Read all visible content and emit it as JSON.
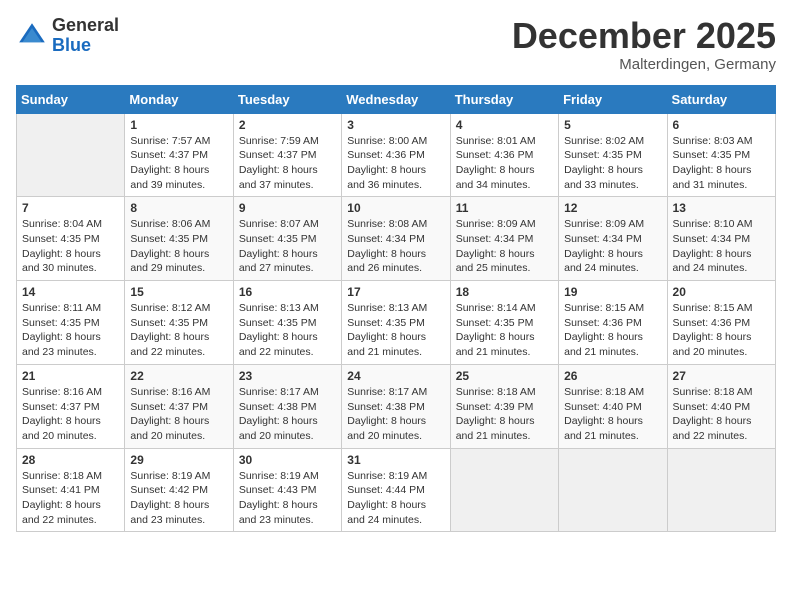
{
  "header": {
    "logo_general": "General",
    "logo_blue": "Blue",
    "month_title": "December 2025",
    "location": "Malterdingen, Germany"
  },
  "weekdays": [
    "Sunday",
    "Monday",
    "Tuesday",
    "Wednesday",
    "Thursday",
    "Friday",
    "Saturday"
  ],
  "weeks": [
    [
      {
        "day": "",
        "sunrise": "",
        "sunset": "",
        "daylight": "",
        "empty": true
      },
      {
        "day": "1",
        "sunrise": "Sunrise: 7:57 AM",
        "sunset": "Sunset: 4:37 PM",
        "daylight": "Daylight: 8 hours and 39 minutes."
      },
      {
        "day": "2",
        "sunrise": "Sunrise: 7:59 AM",
        "sunset": "Sunset: 4:37 PM",
        "daylight": "Daylight: 8 hours and 37 minutes."
      },
      {
        "day": "3",
        "sunrise": "Sunrise: 8:00 AM",
        "sunset": "Sunset: 4:36 PM",
        "daylight": "Daylight: 8 hours and 36 minutes."
      },
      {
        "day": "4",
        "sunrise": "Sunrise: 8:01 AM",
        "sunset": "Sunset: 4:36 PM",
        "daylight": "Daylight: 8 hours and 34 minutes."
      },
      {
        "day": "5",
        "sunrise": "Sunrise: 8:02 AM",
        "sunset": "Sunset: 4:35 PM",
        "daylight": "Daylight: 8 hours and 33 minutes."
      },
      {
        "day": "6",
        "sunrise": "Sunrise: 8:03 AM",
        "sunset": "Sunset: 4:35 PM",
        "daylight": "Daylight: 8 hours and 31 minutes."
      }
    ],
    [
      {
        "day": "7",
        "sunrise": "Sunrise: 8:04 AM",
        "sunset": "Sunset: 4:35 PM",
        "daylight": "Daylight: 8 hours and 30 minutes."
      },
      {
        "day": "8",
        "sunrise": "Sunrise: 8:06 AM",
        "sunset": "Sunset: 4:35 PM",
        "daylight": "Daylight: 8 hours and 29 minutes."
      },
      {
        "day": "9",
        "sunrise": "Sunrise: 8:07 AM",
        "sunset": "Sunset: 4:35 PM",
        "daylight": "Daylight: 8 hours and 27 minutes."
      },
      {
        "day": "10",
        "sunrise": "Sunrise: 8:08 AM",
        "sunset": "Sunset: 4:34 PM",
        "daylight": "Daylight: 8 hours and 26 minutes."
      },
      {
        "day": "11",
        "sunrise": "Sunrise: 8:09 AM",
        "sunset": "Sunset: 4:34 PM",
        "daylight": "Daylight: 8 hours and 25 minutes."
      },
      {
        "day": "12",
        "sunrise": "Sunrise: 8:09 AM",
        "sunset": "Sunset: 4:34 PM",
        "daylight": "Daylight: 8 hours and 24 minutes."
      },
      {
        "day": "13",
        "sunrise": "Sunrise: 8:10 AM",
        "sunset": "Sunset: 4:34 PM",
        "daylight": "Daylight: 8 hours and 24 minutes."
      }
    ],
    [
      {
        "day": "14",
        "sunrise": "Sunrise: 8:11 AM",
        "sunset": "Sunset: 4:35 PM",
        "daylight": "Daylight: 8 hours and 23 minutes."
      },
      {
        "day": "15",
        "sunrise": "Sunrise: 8:12 AM",
        "sunset": "Sunset: 4:35 PM",
        "daylight": "Daylight: 8 hours and 22 minutes."
      },
      {
        "day": "16",
        "sunrise": "Sunrise: 8:13 AM",
        "sunset": "Sunset: 4:35 PM",
        "daylight": "Daylight: 8 hours and 22 minutes."
      },
      {
        "day": "17",
        "sunrise": "Sunrise: 8:13 AM",
        "sunset": "Sunset: 4:35 PM",
        "daylight": "Daylight: 8 hours and 21 minutes."
      },
      {
        "day": "18",
        "sunrise": "Sunrise: 8:14 AM",
        "sunset": "Sunset: 4:35 PM",
        "daylight": "Daylight: 8 hours and 21 minutes."
      },
      {
        "day": "19",
        "sunrise": "Sunrise: 8:15 AM",
        "sunset": "Sunset: 4:36 PM",
        "daylight": "Daylight: 8 hours and 21 minutes."
      },
      {
        "day": "20",
        "sunrise": "Sunrise: 8:15 AM",
        "sunset": "Sunset: 4:36 PM",
        "daylight": "Daylight: 8 hours and 20 minutes."
      }
    ],
    [
      {
        "day": "21",
        "sunrise": "Sunrise: 8:16 AM",
        "sunset": "Sunset: 4:37 PM",
        "daylight": "Daylight: 8 hours and 20 minutes."
      },
      {
        "day": "22",
        "sunrise": "Sunrise: 8:16 AM",
        "sunset": "Sunset: 4:37 PM",
        "daylight": "Daylight: 8 hours and 20 minutes."
      },
      {
        "day": "23",
        "sunrise": "Sunrise: 8:17 AM",
        "sunset": "Sunset: 4:38 PM",
        "daylight": "Daylight: 8 hours and 20 minutes."
      },
      {
        "day": "24",
        "sunrise": "Sunrise: 8:17 AM",
        "sunset": "Sunset: 4:38 PM",
        "daylight": "Daylight: 8 hours and 20 minutes."
      },
      {
        "day": "25",
        "sunrise": "Sunrise: 8:18 AM",
        "sunset": "Sunset: 4:39 PM",
        "daylight": "Daylight: 8 hours and 21 minutes."
      },
      {
        "day": "26",
        "sunrise": "Sunrise: 8:18 AM",
        "sunset": "Sunset: 4:40 PM",
        "daylight": "Daylight: 8 hours and 21 minutes."
      },
      {
        "day": "27",
        "sunrise": "Sunrise: 8:18 AM",
        "sunset": "Sunset: 4:40 PM",
        "daylight": "Daylight: 8 hours and 22 minutes."
      }
    ],
    [
      {
        "day": "28",
        "sunrise": "Sunrise: 8:18 AM",
        "sunset": "Sunset: 4:41 PM",
        "daylight": "Daylight: 8 hours and 22 minutes."
      },
      {
        "day": "29",
        "sunrise": "Sunrise: 8:19 AM",
        "sunset": "Sunset: 4:42 PM",
        "daylight": "Daylight: 8 hours and 23 minutes."
      },
      {
        "day": "30",
        "sunrise": "Sunrise: 8:19 AM",
        "sunset": "Sunset: 4:43 PM",
        "daylight": "Daylight: 8 hours and 23 minutes."
      },
      {
        "day": "31",
        "sunrise": "Sunrise: 8:19 AM",
        "sunset": "Sunset: 4:44 PM",
        "daylight": "Daylight: 8 hours and 24 minutes."
      },
      {
        "day": "",
        "sunrise": "",
        "sunset": "",
        "daylight": "",
        "empty": true
      },
      {
        "day": "",
        "sunrise": "",
        "sunset": "",
        "daylight": "",
        "empty": true
      },
      {
        "day": "",
        "sunrise": "",
        "sunset": "",
        "daylight": "",
        "empty": true
      }
    ]
  ]
}
